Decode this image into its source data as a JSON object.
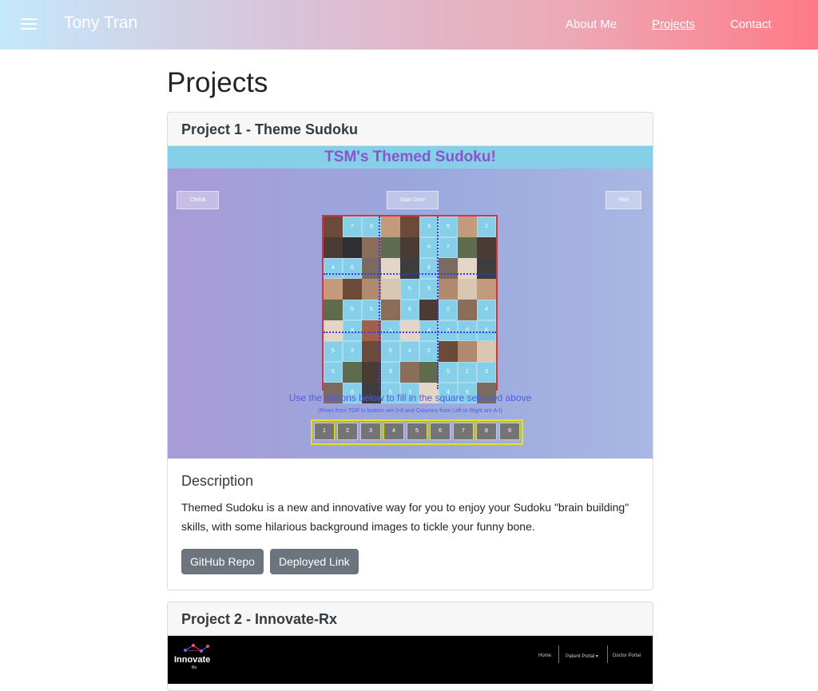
{
  "navbar": {
    "brand": "Tony Tran",
    "links": [
      "About Me",
      "Projects",
      "Contact"
    ]
  },
  "page": {
    "title": "Projects"
  },
  "projects": [
    {
      "title": "Project 1 - Theme Sudoku",
      "preview": {
        "banner": "TSM's Themed Sudoku!",
        "buttons": [
          "Check",
          "Start Over",
          "Hint"
        ],
        "instruction": "Use the buttons below to fill in the square selected above",
        "sub_instruction": "(Rows from TOP to bottom are 0-8 and Columns from Left to Right are A-I)",
        "number_buttons": [
          "1",
          "2",
          "3",
          "4",
          "5",
          "6",
          "7",
          "8",
          "9"
        ],
        "grid": [
          [
            "",
            "7",
            "8",
            "",
            "",
            "3",
            "6",
            "",
            "2"
          ],
          [
            "",
            "",
            "",
            "",
            "",
            "6",
            "7",
            "",
            ""
          ],
          [
            "4",
            "6",
            "",
            "",
            "",
            "8",
            "",
            "",
            ""
          ],
          [
            "",
            "",
            "",
            "",
            "6",
            "5",
            "",
            "",
            ""
          ],
          [
            "",
            "5",
            "6",
            "",
            "8",
            "",
            "2",
            "",
            "4"
          ],
          [
            "",
            "9",
            "",
            "1",
            "",
            "4",
            "3",
            "5",
            "6"
          ],
          [
            "5",
            "3",
            "",
            "6",
            "4",
            "2",
            "",
            "",
            ""
          ],
          [
            "6",
            "",
            "",
            "8",
            "",
            "",
            "5",
            "2",
            "3"
          ],
          [
            "",
            "8",
            "",
            "5",
            "3",
            "",
            "4",
            "6",
            ""
          ]
        ]
      },
      "description_title": "Description",
      "description": "Themed Sudoku is a new and innovative way for you to enjoy your Sudoku \"brain building\" skills, with some hilarious background images to tickle your funny bone.",
      "buttons": [
        "GitHub Repo",
        "Deployed Link"
      ]
    },
    {
      "title": "Project 2 - Innovate-Rx",
      "preview": {
        "logo": "Innovate",
        "logo_sub": "Rx",
        "nav": [
          "Home",
          "Patient Portal ▾",
          "Doctor Portal"
        ]
      }
    }
  ],
  "colors": {
    "nav_gradient": [
      "#c4e8fb",
      "#ff7a86"
    ],
    "button": "#6c757d",
    "sudoku_banner": "#86cfe8",
    "sudoku_title": "#8a55cc"
  }
}
